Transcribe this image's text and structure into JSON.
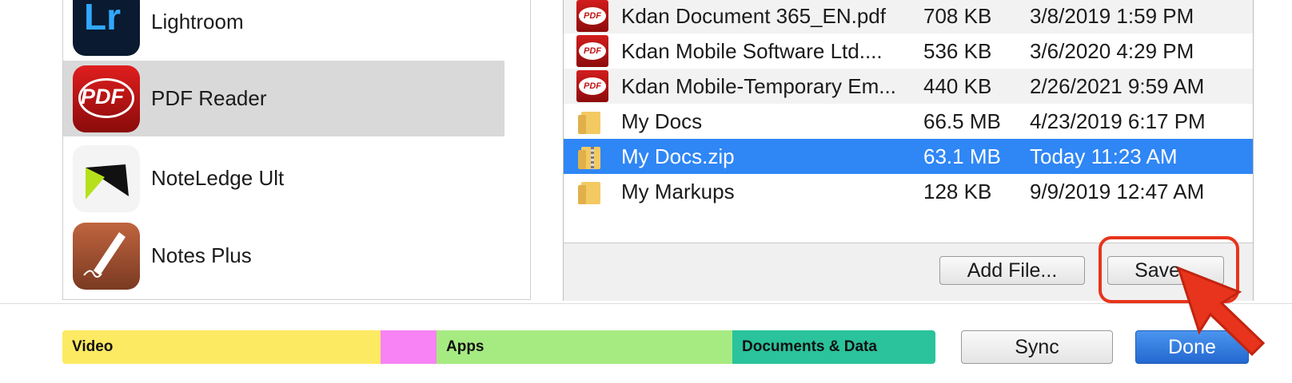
{
  "apps": [
    {
      "name": "Lightroom",
      "icon": "lightroom-icon"
    },
    {
      "name": "PDF Reader",
      "icon": "pdf-reader-icon"
    },
    {
      "name": "NoteLedge Ult",
      "icon": "noteledge-icon"
    },
    {
      "name": "Notes Plus",
      "icon": "notes-plus-icon"
    }
  ],
  "app_icon_text": {
    "lightroom": "Lr",
    "pdf": "PDF"
  },
  "files": [
    {
      "name": "Kdan Document 365_EN.pdf",
      "size": "708 KB",
      "date": "3/8/2019 1:59 PM",
      "type": "pdf"
    },
    {
      "name": "Kdan Mobile Software Ltd....",
      "size": "536 KB",
      "date": "3/6/2020 4:29 PM",
      "type": "pdf"
    },
    {
      "name": "Kdan Mobile-Temporary Em...",
      "size": "440 KB",
      "date": "2/26/2021 9:59 AM",
      "type": "pdf"
    },
    {
      "name": "My Docs",
      "size": "66.5 MB",
      "date": "4/23/2019 6:17 PM",
      "type": "folder"
    },
    {
      "name": "My Docs.zip",
      "size": "63.1 MB",
      "date": "Today 11:23 AM",
      "type": "zip",
      "selected": true
    },
    {
      "name": "My Markups",
      "size": "128 KB",
      "date": "9/9/2019 12:47 AM",
      "type": "folder"
    }
  ],
  "pdf_icon_label": "PDF",
  "buttons": {
    "add_file": "Add File...",
    "save": "Save...",
    "sync": "Sync",
    "done": "Done"
  },
  "storage": {
    "segments": [
      {
        "label": "Video",
        "color": "#fdea63"
      },
      {
        "label": "",
        "color": "#f883f4"
      },
      {
        "label": "Apps",
        "color": "#a6eb82"
      },
      {
        "label": "Documents & Data",
        "color": "#2ac39b"
      }
    ]
  },
  "colors": {
    "selection": "#2f86f5",
    "highlight_ring": "#e8341c",
    "done_button": "#2e7ee0"
  }
}
